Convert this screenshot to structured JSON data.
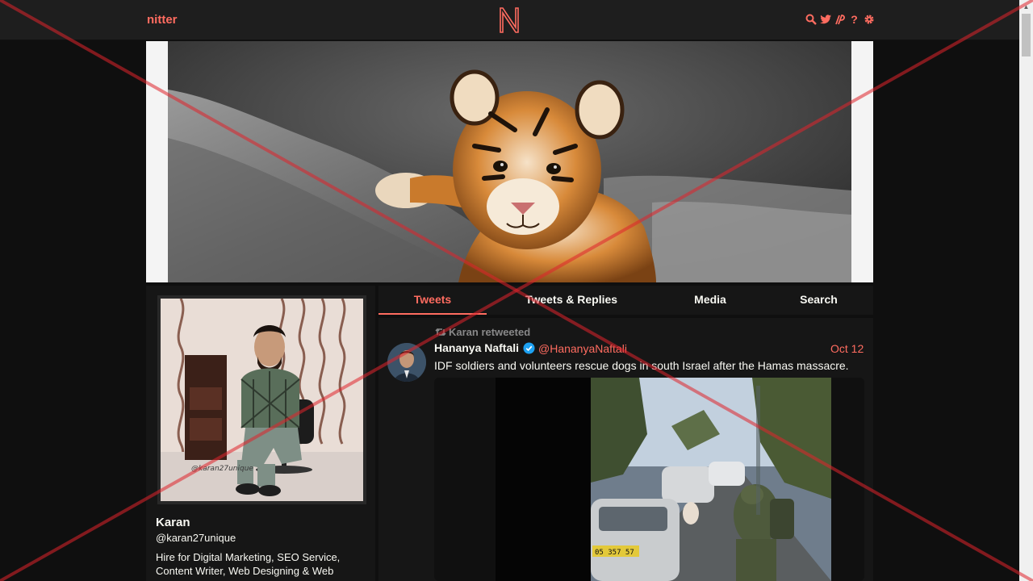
{
  "nav": {
    "brand": "nitter",
    "logo_letter": "N",
    "icons": [
      "search-icon",
      "twitter-bird-icon",
      "rss-icon",
      "help-icon",
      "gear-icon"
    ],
    "help_glyph": "?"
  },
  "banner": {
    "description_icon": "tiger-cub-banner-image"
  },
  "profile": {
    "name": "Karan",
    "handle": "@karan27unique",
    "bio": "Hire for Digital Marketing, SEO Service, Content Writer, Web Designing & Web",
    "avatar_watermark": "@karan27unique"
  },
  "tabs": [
    {
      "label": "Tweets",
      "active": true
    },
    {
      "label": "Tweets & Replies",
      "active": false
    },
    {
      "label": "Media",
      "active": false
    },
    {
      "label": "Search",
      "active": false
    }
  ],
  "tweet": {
    "retweet_label": "Karan retweeted",
    "fullname": "Hananya Naftali",
    "username": "@HananyaNaftali",
    "date": "Oct 12",
    "text": "IDF soldiers and volunteers rescue dogs in south Israel after the Hamas massacre.",
    "plate_text": "05 357 57"
  },
  "colors": {
    "accent": "#ff6c60",
    "background": "#0f0f0f",
    "panel": "#161616",
    "navbar": "#1e1e1e",
    "muted": "#888889",
    "verified": "#1da1f2"
  }
}
